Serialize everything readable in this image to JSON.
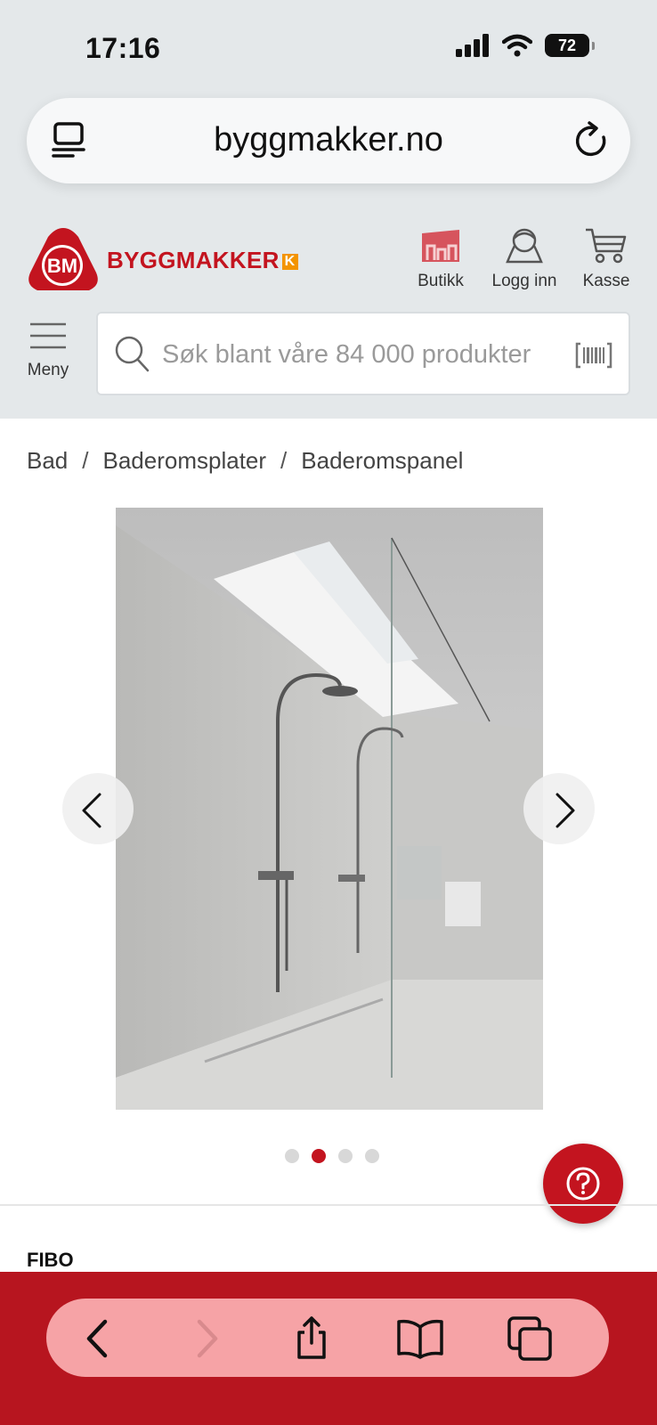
{
  "status_bar": {
    "time": "17:16",
    "battery": "72"
  },
  "browser": {
    "url": "byggmakker.no"
  },
  "header": {
    "logo_badge": "BM",
    "logo_word": "BYGGMAKKER",
    "logo_k": "K",
    "actions": [
      {
        "label": "Butikk",
        "icon": "store-icon"
      },
      {
        "label": "Logg inn",
        "icon": "user-icon"
      },
      {
        "label": "Kasse",
        "icon": "cart-icon"
      }
    ]
  },
  "menu": {
    "label": "Meny"
  },
  "search": {
    "placeholder": "Søk blant våre 84 000 produkter"
  },
  "breadcrumb": [
    "Bad",
    "Baderomsplater",
    "Baderomspanel"
  ],
  "gallery": {
    "image_count": 4,
    "active_index": 1
  },
  "product": {
    "brand": "FIBO"
  },
  "colors": {
    "brand_red": "#c3141f",
    "accent_orange": "#f39400",
    "bottom_bar": "#b7151f",
    "pill": "#f6a3a6"
  }
}
